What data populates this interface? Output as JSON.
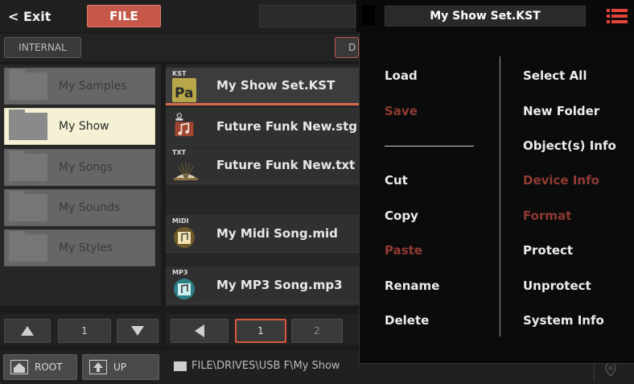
{
  "topbar": {
    "exit_label": "< Exit",
    "file_tab_label": "FILE",
    "title": "My Show Set.KST"
  },
  "secondbar": {
    "device_label": "INTERNAL",
    "partial_button_label": "D"
  },
  "folders": [
    {
      "label": "My Samples",
      "selected": false
    },
    {
      "label": "My Show",
      "selected": true
    },
    {
      "label": "My Songs",
      "selected": false
    },
    {
      "label": "My Sounds",
      "selected": false
    },
    {
      "label": "My Styles",
      "selected": false
    }
  ],
  "files": [
    {
      "ext": "KST",
      "name": "My Show Set.KST",
      "icon": "kst-file-icon",
      "selected": true
    },
    {
      "ext": "",
      "name": "Future Funk New.stg",
      "icon": "song-file-icon",
      "selected": false
    },
    {
      "ext": "TXT",
      "name": "Future Funk New.txt",
      "icon": "text-file-icon",
      "selected": false
    },
    {
      "ext": "MIDI",
      "name": "My Midi Song.mid",
      "icon": "midi-file-icon",
      "selected": false
    },
    {
      "ext": "MP3",
      "name": "My MP3 Song.mp3",
      "icon": "mp3-file-icon",
      "selected": false
    }
  ],
  "left_pager": {
    "page": "1"
  },
  "right_pager": {
    "current_page": "1",
    "next_page": "2"
  },
  "status": {
    "root_label": "ROOT",
    "up_label": "UP",
    "path": "FILE\\DRIVES\\USB F\\My Show"
  },
  "menu": {
    "left": [
      {
        "label": "Load",
        "enabled": true
      },
      {
        "label": "Save",
        "enabled": false
      },
      {
        "label": "Cut",
        "enabled": true
      },
      {
        "label": "Copy",
        "enabled": true
      },
      {
        "label": "Paste",
        "enabled": false
      },
      {
        "label": "Rename",
        "enabled": true
      },
      {
        "label": "Delete",
        "enabled": true
      }
    ],
    "right": [
      {
        "label": "Select All",
        "enabled": true
      },
      {
        "label": "New Folder",
        "enabled": true
      },
      {
        "label": "Object(s) Info",
        "enabled": true
      },
      {
        "label": "Device Info",
        "enabled": false
      },
      {
        "label": "Format",
        "enabled": false
      },
      {
        "label": "Protect",
        "enabled": true
      },
      {
        "label": "Unprotect",
        "enabled": true
      },
      {
        "label": "System Info",
        "enabled": true
      }
    ]
  },
  "colors": {
    "accent": "#c55848",
    "selection_underline": "#d86a4e",
    "disabled_menu_text": "#8f3b33",
    "menu_icon": "#e5443a",
    "selected_folder": "#f5f1d4"
  }
}
